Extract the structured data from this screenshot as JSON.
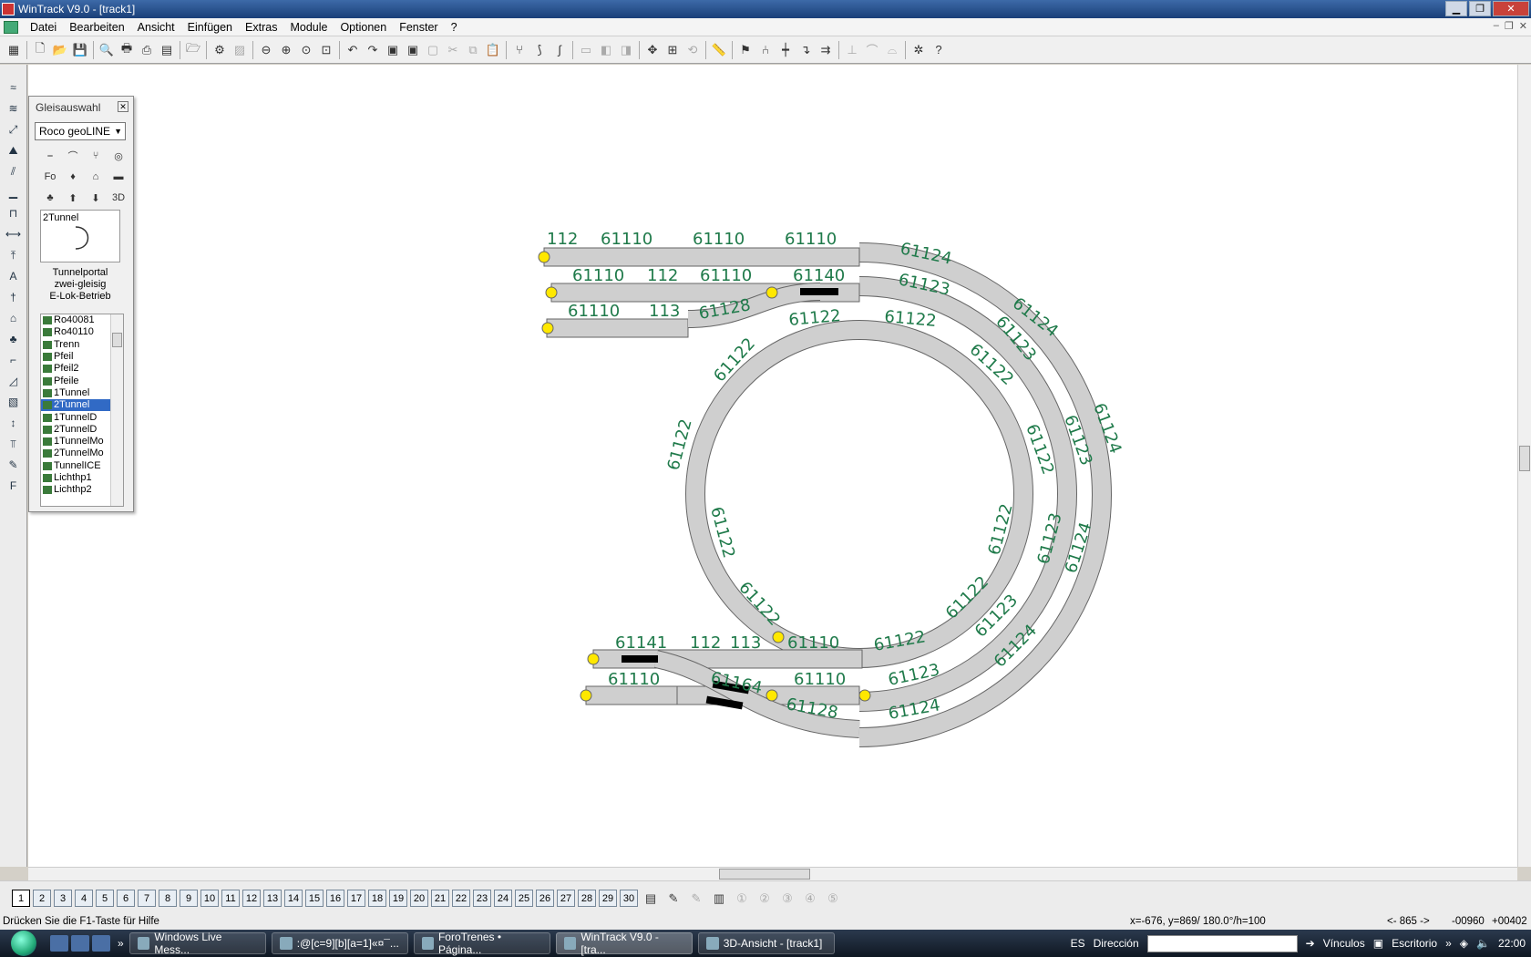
{
  "window": {
    "title": "WinTrack  V9.0 - [track1]"
  },
  "menu": [
    "Datei",
    "Bearbeiten",
    "Ansicht",
    "Einfügen",
    "Extras",
    "Module",
    "Optionen",
    "Fenster",
    "?"
  ],
  "palette": {
    "title": "Gleisauswahl",
    "manufacturer": "Roco geoLINE",
    "preview_name": "2Tunnel",
    "description": [
      "Tunnelportal",
      "zwei-gleisig",
      "E-Lok-Betrieb"
    ],
    "items": [
      "Ro40081",
      "Ro40110",
      "Trenn",
      "Pfeil",
      "Pfeil2",
      "Pfeile",
      "1Tunnel",
      "2Tunnel",
      "1TunnelD",
      "2TunnelD",
      "1TunnelMo",
      "2TunnelMo",
      "TunnelICE",
      "Lichthp1",
      "Lichthp2"
    ],
    "selected_item": "2Tunnel"
  },
  "track_labels": [
    {
      "text": "112"
    },
    {
      "text": "61110"
    },
    {
      "text": "61110"
    },
    {
      "text": "61110"
    },
    {
      "text": "61124"
    },
    {
      "text": "61110"
    },
    {
      "text": "112"
    },
    {
      "text": "61110"
    },
    {
      "text": "61140"
    },
    {
      "text": "61123"
    },
    {
      "text": "61110"
    },
    {
      "text": "113"
    },
    {
      "text": "61128"
    },
    {
      "text": "61122"
    },
    {
      "text": "61122"
    },
    {
      "text": "61124"
    },
    {
      "text": "61123"
    },
    {
      "text": "61122"
    },
    {
      "text": "61122"
    },
    {
      "text": "61122"
    },
    {
      "text": "61124"
    },
    {
      "text": "61123"
    },
    {
      "text": "61122"
    },
    {
      "text": "61122"
    },
    {
      "text": "61122"
    },
    {
      "text": "61123"
    },
    {
      "text": "61124"
    },
    {
      "text": "61122"
    },
    {
      "text": "61122"
    },
    {
      "text": "61123"
    },
    {
      "text": "61124"
    },
    {
      "text": "61141"
    },
    {
      "text": "112"
    },
    {
      "text": "113"
    },
    {
      "text": "61110"
    },
    {
      "text": "61122"
    },
    {
      "text": "61110"
    },
    {
      "text": "61164"
    },
    {
      "text": "61110"
    },
    {
      "text": "61123"
    },
    {
      "text": "61128"
    },
    {
      "text": "61124"
    }
  ],
  "layers": [
    "1",
    "2",
    "3",
    "4",
    "5",
    "6",
    "7",
    "8",
    "9",
    "10",
    "11",
    "12",
    "13",
    "14",
    "15",
    "16",
    "17",
    "18",
    "19",
    "20",
    "21",
    "22",
    "23",
    "24",
    "25",
    "26",
    "27",
    "28",
    "29",
    "30"
  ],
  "status": {
    "help": "Drücken Sie die  F1-Taste für Hilfe",
    "coords": "x=-676, y=869/ 180.0°/h=100",
    "range": "<- 865 ->",
    "val1": "-00960",
    "val2": "+00402"
  },
  "taskbar": {
    "tasks": [
      "Windows Live Mess...",
      ":@[c=9][b][a=1]«¤¯...",
      "ForoTrenes • Página...",
      "WinTrack  V9.0 - [tra...",
      "3D-Ansicht - [track1]"
    ],
    "lang": "ES",
    "address_label": "Dirección",
    "links": "Vínculos",
    "desktop": "Escritorio",
    "clock": "22:00"
  }
}
